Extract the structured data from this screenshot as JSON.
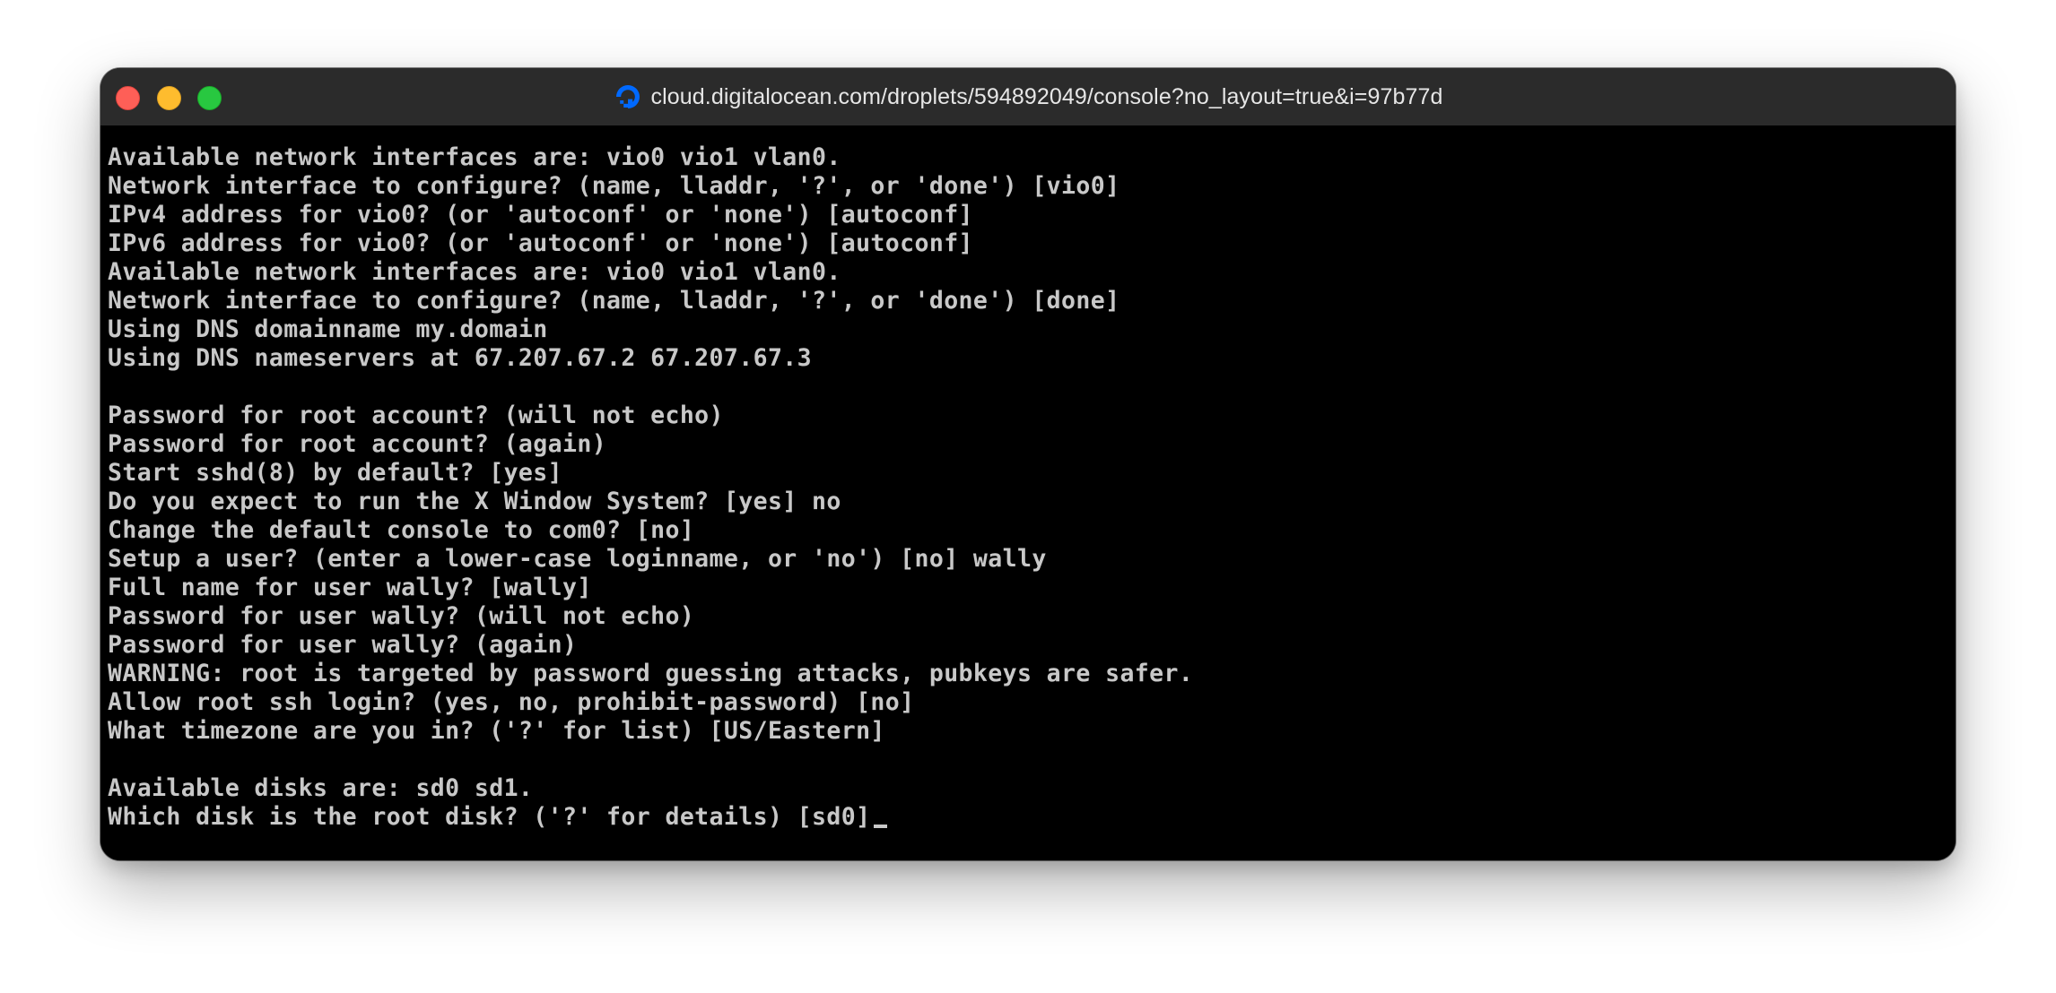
{
  "window": {
    "title": "cloud.digitalocean.com/droplets/594892049/console?no_layout=true&i=97b77d",
    "favicon": "digitalocean-logo-icon",
    "accent_color": "#0069ff"
  },
  "console": {
    "lines": [
      "Available network interfaces are: vio0 vio1 vlan0.",
      "Network interface to configure? (name, lladdr, '?', or 'done') [vio0]",
      "IPv4 address for vio0? (or 'autoconf' or 'none') [autoconf]",
      "IPv6 address for vio0? (or 'autoconf' or 'none') [autoconf]",
      "Available network interfaces are: vio0 vio1 vlan0.",
      "Network interface to configure? (name, lladdr, '?', or 'done') [done]",
      "Using DNS domainname my.domain",
      "Using DNS nameservers at 67.207.67.2 67.207.67.3",
      "",
      "Password for root account? (will not echo)",
      "Password for root account? (again)",
      "Start sshd(8) by default? [yes]",
      "Do you expect to run the X Window System? [yes] no",
      "Change the default console to com0? [no]",
      "Setup a user? (enter a lower-case loginname, or 'no') [no] wally",
      "Full name for user wally? [wally]",
      "Password for user wally? (will not echo)",
      "Password for user wally? (again)",
      "WARNING: root is targeted by password guessing attacks, pubkeys are safer.",
      "Allow root ssh login? (yes, no, prohibit-password) [no]",
      "What timezone are you in? ('?' for list) [US/Eastern]",
      "",
      "Available disks are: sd0 sd1.",
      "Which disk is the root disk? ('?' for details) [sd0]"
    ]
  }
}
